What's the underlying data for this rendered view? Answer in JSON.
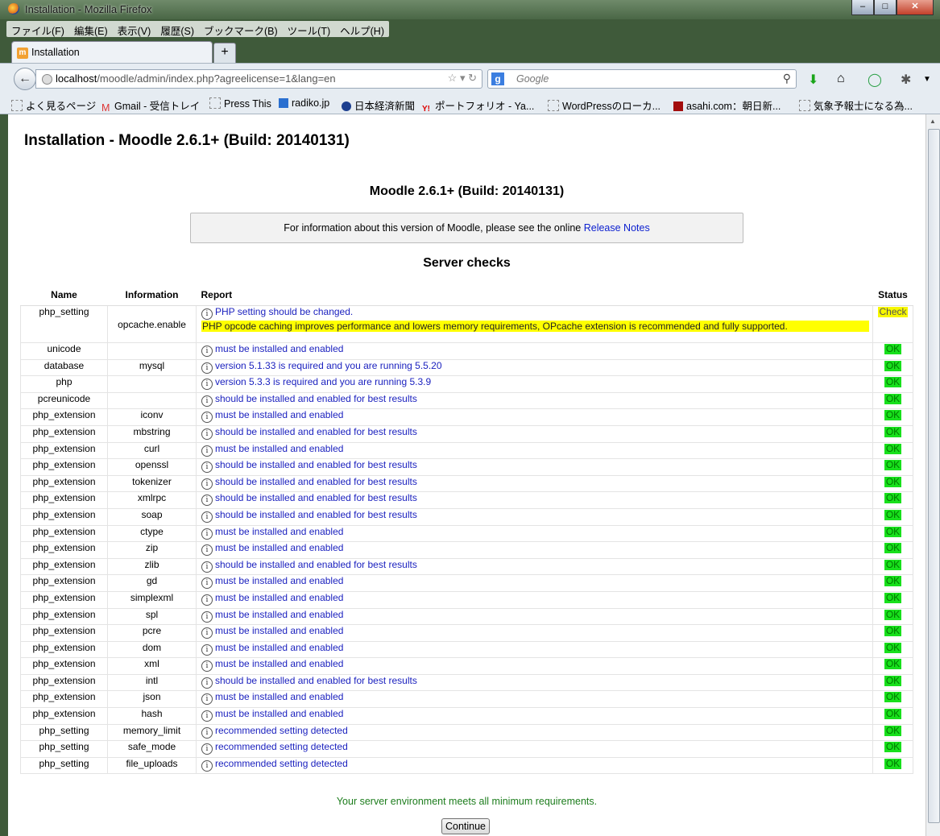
{
  "window": {
    "title": "Installation - Mozilla Firefox"
  },
  "menu": [
    "ファイル(F)",
    "編集(E)",
    "表示(V)",
    "履歴(S)",
    "ブックマーク(B)",
    "ツール(T)",
    "ヘルプ(H)"
  ],
  "tab": {
    "label": "Installation",
    "new_tab": "+"
  },
  "address": {
    "host": "localhost",
    "path": "/moodle/admin/index.php?agreelicense=1&lang=en"
  },
  "search": {
    "placeholder": "Google"
  },
  "bookmarks": [
    "よく見るページ",
    "Gmail - 受信トレイ",
    "Press This",
    "radiko.jp",
    "日本経済新聞",
    "ポートフォリオ - Ya...",
    "WordPressのローカ...",
    "asahi.com：朝日新...",
    "気象予報士になる為..."
  ],
  "page": {
    "title": "Installation - Moodle 2.6.1+ (Build: 20140131)",
    "version_heading": "Moodle 2.6.1+ (Build: 20140131)",
    "info_text": "For information about this version of Moodle, please see the online ",
    "release_notes": "Release Notes",
    "server_checks": "Server checks",
    "env_message": "Your server environment meets all minimum requirements.",
    "continue": "Continue"
  },
  "table": {
    "headers": {
      "name": "Name",
      "information": "Information",
      "report": "Report",
      "status": "Status"
    },
    "rows": [
      {
        "name": "php_setting",
        "info": "opcache.enable",
        "report": "PHP setting should be changed.",
        "extra": "PHP opcode caching improves performance and lowers memory requirements, OPcache extension is recommended and fully supported.",
        "status": "Check"
      },
      {
        "name": "unicode",
        "info": "",
        "report": "must be installed and enabled",
        "status": "OK"
      },
      {
        "name": "database",
        "info": "mysql",
        "report": "version 5.1.33 is required and you are running 5.5.20",
        "status": "OK"
      },
      {
        "name": "php",
        "info": "",
        "report": "version 5.3.3 is required and you are running 5.3.9",
        "status": "OK"
      },
      {
        "name": "pcreunicode",
        "info": "",
        "report": "should be installed and enabled for best results",
        "status": "OK"
      },
      {
        "name": "php_extension",
        "info": "iconv",
        "report": "must be installed and enabled",
        "status": "OK"
      },
      {
        "name": "php_extension",
        "info": "mbstring",
        "report": "should be installed and enabled for best results",
        "status": "OK"
      },
      {
        "name": "php_extension",
        "info": "curl",
        "report": "must be installed and enabled",
        "status": "OK"
      },
      {
        "name": "php_extension",
        "info": "openssl",
        "report": "should be installed and enabled for best results",
        "status": "OK"
      },
      {
        "name": "php_extension",
        "info": "tokenizer",
        "report": "should be installed and enabled for best results",
        "status": "OK"
      },
      {
        "name": "php_extension",
        "info": "xmlrpc",
        "report": "should be installed and enabled for best results",
        "status": "OK"
      },
      {
        "name": "php_extension",
        "info": "soap",
        "report": "should be installed and enabled for best results",
        "status": "OK"
      },
      {
        "name": "php_extension",
        "info": "ctype",
        "report": "must be installed and enabled",
        "status": "OK"
      },
      {
        "name": "php_extension",
        "info": "zip",
        "report": "must be installed and enabled",
        "status": "OK"
      },
      {
        "name": "php_extension",
        "info": "zlib",
        "report": "should be installed and enabled for best results",
        "status": "OK"
      },
      {
        "name": "php_extension",
        "info": "gd",
        "report": "must be installed and enabled",
        "status": "OK"
      },
      {
        "name": "php_extension",
        "info": "simplexml",
        "report": "must be installed and enabled",
        "status": "OK"
      },
      {
        "name": "php_extension",
        "info": "spl",
        "report": "must be installed and enabled",
        "status": "OK"
      },
      {
        "name": "php_extension",
        "info": "pcre",
        "report": "must be installed and enabled",
        "status": "OK"
      },
      {
        "name": "php_extension",
        "info": "dom",
        "report": "must be installed and enabled",
        "status": "OK"
      },
      {
        "name": "php_extension",
        "info": "xml",
        "report": "must be installed and enabled",
        "status": "OK"
      },
      {
        "name": "php_extension",
        "info": "intl",
        "report": "should be installed and enabled for best results",
        "status": "OK"
      },
      {
        "name": "php_extension",
        "info": "json",
        "report": "must be installed and enabled",
        "status": "OK"
      },
      {
        "name": "php_extension",
        "info": "hash",
        "report": "must be installed and enabled",
        "status": "OK"
      },
      {
        "name": "php_setting",
        "info": "memory_limit",
        "report": "recommended setting detected",
        "status": "OK"
      },
      {
        "name": "php_setting",
        "info": "safe_mode",
        "report": "recommended setting detected",
        "status": "OK"
      },
      {
        "name": "php_setting",
        "info": "file_uploads",
        "report": "recommended setting detected",
        "status": "OK"
      }
    ]
  },
  "colors": {
    "ok_bg": "#18e01c",
    "check_bg": "#f7f700",
    "link": "#1c22bf",
    "env_ok": "#1d7d1d"
  }
}
